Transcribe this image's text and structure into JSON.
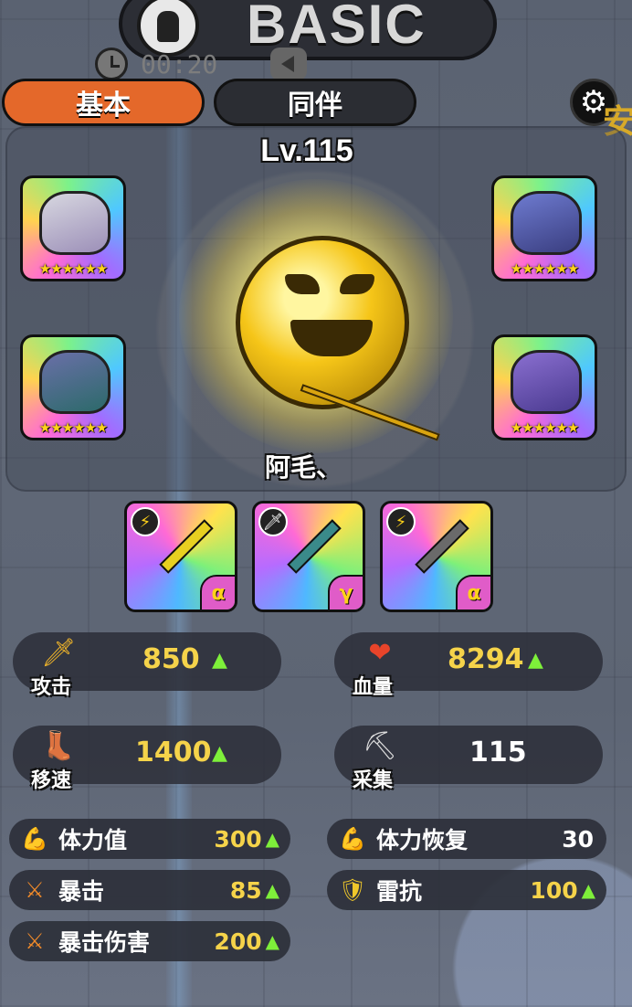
{
  "header": {
    "title": "BASIC",
    "timer": "00:20"
  },
  "tabs": {
    "basic": "基本",
    "companion": "同伴"
  },
  "side_glyph": "安",
  "hero": {
    "level": "Lv.115",
    "name": "阿毛、"
  },
  "companions": [
    {
      "stars": "★★★★★★"
    },
    {
      "stars": "★★★★★★"
    },
    {
      "stars": "★★★★★★"
    },
    {
      "stars": "★★★★★★"
    }
  ],
  "weapons": [
    {
      "grade": "α",
      "icon": "lightning-icon"
    },
    {
      "grade": "γ",
      "icon": "sword-icon"
    },
    {
      "grade": "α",
      "icon": "lightning-icon"
    }
  ],
  "stats_main": {
    "attack": {
      "label": "攻击",
      "value": "850",
      "arrow": "▲"
    },
    "hp": {
      "label": "血量",
      "value": "8294",
      "arrow": "▲"
    },
    "speed": {
      "label": "移速",
      "value": "1400",
      "arrow": "▲"
    },
    "gather": {
      "label": "采集",
      "value": "115"
    }
  },
  "stats_sub": {
    "stamina": {
      "label": "体力值",
      "value": "300",
      "arrow": "▲"
    },
    "stamina_regen": {
      "label": "体力恢复",
      "value": "30"
    },
    "crit": {
      "label": "暴击",
      "value": "85",
      "arrow": "▲"
    },
    "thunder_res": {
      "label": "雷抗",
      "value": "100",
      "arrow": "▲"
    },
    "crit_damage": {
      "label": "暴击伤害",
      "value": "200",
      "arrow": "▲"
    }
  },
  "colors": {
    "accent_tab": "#e4682a",
    "value_gold": "#f5d34a",
    "arrow_green": "#7ef03a",
    "star_gold": "#ffd21a"
  }
}
